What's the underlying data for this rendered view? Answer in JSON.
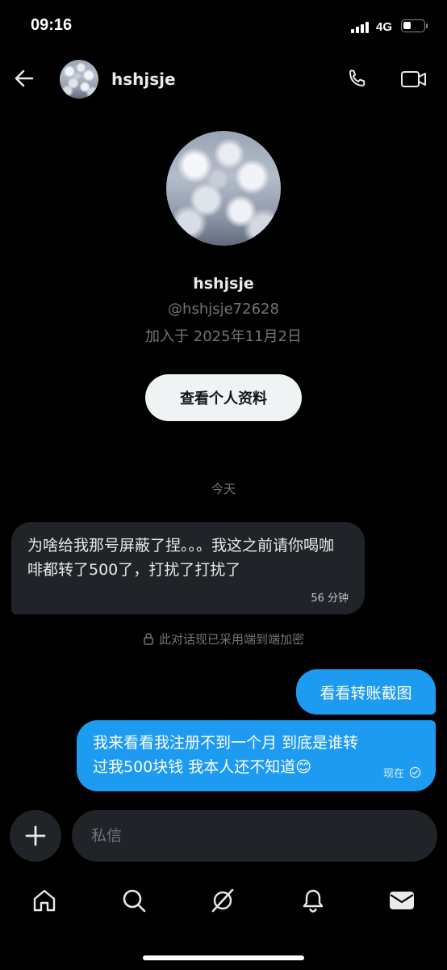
{
  "status_bar": {
    "time": "09:16",
    "network": "4G"
  },
  "header": {
    "name": "hshjsje",
    "back_icon": "arrow-left-icon",
    "call_icon": "phone-icon",
    "video_icon": "video-icon"
  },
  "profile": {
    "name": "hshjsje",
    "handle": "@hshjsje72628",
    "joined": "加入于 2025年11月2日",
    "view_profile_label": "查看个人资料"
  },
  "conversation": {
    "day_label": "今天",
    "messages": [
      {
        "direction": "in",
        "text": "为啥给我那号屏蔽了捏。。。我这之前请你喝咖啡都转了500了，打扰了打扰了",
        "time": "56 分钟"
      },
      {
        "direction": "out",
        "text": "看看转账截图"
      },
      {
        "direction": "out",
        "text": "我来看看我注册不到一个月 到底是谁转过我500块钱 我本人还不知道😊",
        "time": "现在"
      }
    ],
    "encryption_notice": "此对话现已采用端到端加密"
  },
  "composer": {
    "placeholder": "私信"
  },
  "bottom_nav": [
    "home-icon",
    "search-icon",
    "grok-icon",
    "bell-icon",
    "mail-icon"
  ],
  "colors": {
    "background": "#000000",
    "accent": "#1d9bf0",
    "bubble_in": "#202327",
    "muted": "#71767b"
  }
}
